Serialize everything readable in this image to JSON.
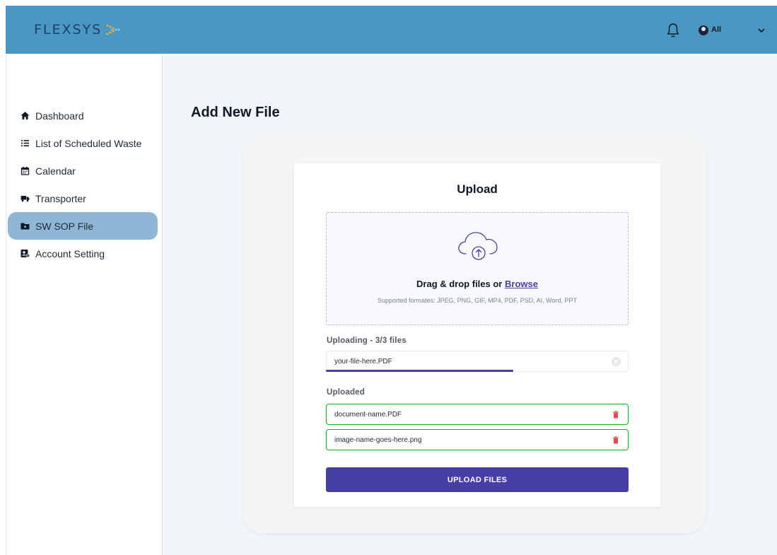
{
  "header": {
    "logo_text": "FLEXSYS",
    "user_label": "All",
    "bg_color": "#4a98c2"
  },
  "sidebar": {
    "items": [
      {
        "label": "Dashboard",
        "icon": "home-icon"
      },
      {
        "label": "List of Scheduled Waste",
        "icon": "list-icon"
      },
      {
        "label": "Calendar",
        "icon": "calendar-icon"
      },
      {
        "label": "Transporter",
        "icon": "truck-icon"
      },
      {
        "label": "SW SOP File",
        "icon": "folder-icon",
        "active": true
      },
      {
        "label": "Account Setting",
        "icon": "account-settings-icon"
      }
    ],
    "active_color": "#8fb6d5"
  },
  "main": {
    "page_title": "Add New File"
  },
  "upload": {
    "title": "Upload",
    "drag_text": "Drag & drop files or",
    "browse_label": "Browse",
    "formats": "Supported formates: JPEG, PNG, GIF, MP4, PDF, PSD, AI, Word, PPT",
    "uploading_label": "Uploading - 3/3 files",
    "uploading_file": "your-file-here.PDF",
    "uploading_progress": 0.62,
    "uploaded_label": "Uploaded",
    "uploaded_files": [
      "document-name.PDF",
      "image-name-goes-here.png"
    ],
    "button_label": "UPLOAD FILES",
    "accent_color": "#483ea8",
    "success_color": "#11af22"
  }
}
